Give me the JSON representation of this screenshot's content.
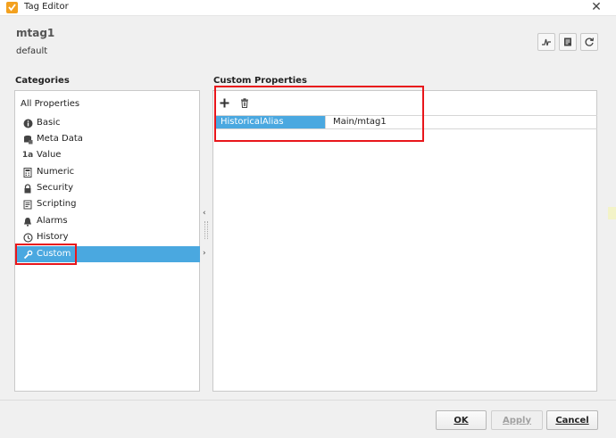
{
  "window": {
    "title": "Tag Editor"
  },
  "header": {
    "tag_name": "mtag1",
    "provider": "default"
  },
  "categories": {
    "title": "Categories",
    "all_label": "All Properties",
    "items": [
      {
        "label": "Basic",
        "icon": "info-icon"
      },
      {
        "label": "Meta Data",
        "icon": "database-icon"
      },
      {
        "label": "Value",
        "icon": "value-icon"
      },
      {
        "label": "Numeric",
        "icon": "calculator-icon"
      },
      {
        "label": "Security",
        "icon": "lock-icon"
      },
      {
        "label": "Scripting",
        "icon": "script-icon"
      },
      {
        "label": "Alarms",
        "icon": "bell-icon"
      },
      {
        "label": "History",
        "icon": "clock-icon"
      },
      {
        "label": "Custom",
        "icon": "wrench-icon",
        "selected": true
      }
    ]
  },
  "custom_properties": {
    "title": "Custom Properties",
    "rows": [
      {
        "key": "HistoricalAlias",
        "value": "Main/mtag1"
      }
    ]
  },
  "footer": {
    "ok": "OK",
    "apply": "Apply",
    "cancel": "Cancel"
  },
  "colors": {
    "selection": "#4aa8e0",
    "highlight": "#e8161b",
    "app_icon": "#f3a11f"
  }
}
